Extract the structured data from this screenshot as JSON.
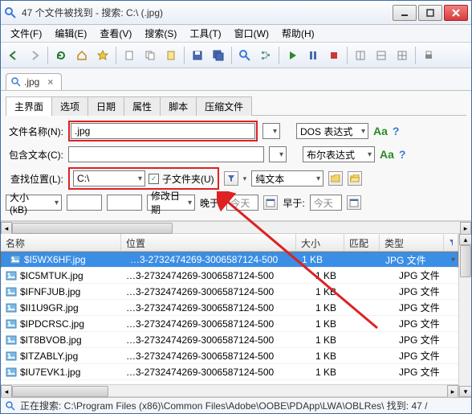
{
  "window": {
    "title": "47 个文件被找到 - 搜索: C:\\ (.jpg)"
  },
  "menu": {
    "file": "文件(F)",
    "edit": "编辑(E)",
    "view": "查看(V)",
    "search": "搜索(S)",
    "tools": "工具(T)",
    "window": "窗口(W)",
    "help": "帮助(H)"
  },
  "tab": {
    "label": ".jpg"
  },
  "subtabs": [
    "主界面",
    "选项",
    "日期",
    "属性",
    "脚本",
    "压缩文件"
  ],
  "form": {
    "filename_label": "文件名称(N):",
    "filename_value": ".jpg",
    "contains_label": "包含文本(C):",
    "contains_value": "",
    "location_label": "查找位置(L):",
    "location_value": "C:\\",
    "subfolders_label": "子文件夹(U)",
    "expr_dos": "DOS 表达式",
    "expr_bool": "布尔表达式",
    "expr_plain": "纯文本",
    "size_label": "大小 (kB)",
    "moddate_label": "修改日期",
    "later_label": "晚于:",
    "earlier_label": "早于:",
    "today": "今天"
  },
  "columns": {
    "name": "名称",
    "location": "位置",
    "size": "大小",
    "match": "匹配",
    "type": "类型"
  },
  "rows": [
    {
      "name": "$I5WX6HF.jpg",
      "loc": "…3-2732474269-3006587124-500",
      "size": "1 KB",
      "type": "JPG 文件",
      "sel": true
    },
    {
      "name": "$IC5MTUK.jpg",
      "loc": "…3-2732474269-3006587124-500",
      "size": "1 KB",
      "type": "JPG 文件",
      "sel": false
    },
    {
      "name": "$IFNFJUB.jpg",
      "loc": "…3-2732474269-3006587124-500",
      "size": "1 KB",
      "type": "JPG 文件",
      "sel": false
    },
    {
      "name": "$II1U9GR.jpg",
      "loc": "…3-2732474269-3006587124-500",
      "size": "1 KB",
      "type": "JPG 文件",
      "sel": false
    },
    {
      "name": "$IPDCRSC.jpg",
      "loc": "…3-2732474269-3006587124-500",
      "size": "1 KB",
      "type": "JPG 文件",
      "sel": false
    },
    {
      "name": "$IT8BVOB.jpg",
      "loc": "…3-2732474269-3006587124-500",
      "size": "1 KB",
      "type": "JPG 文件",
      "sel": false
    },
    {
      "name": "$ITZABLY.jpg",
      "loc": "…3-2732474269-3006587124-500",
      "size": "1 KB",
      "type": "JPG 文件",
      "sel": false
    },
    {
      "name": "$IU7EVK1.jpg",
      "loc": "…3-2732474269-3006587124-500",
      "size": "1 KB",
      "type": "JPG 文件",
      "sel": false
    }
  ],
  "status": {
    "text": "正在搜索: C:\\Program Files (x86)\\Common Files\\Adobe\\OOBE\\PDApp\\LWA\\OBLRes\\  找到: 47 /"
  }
}
